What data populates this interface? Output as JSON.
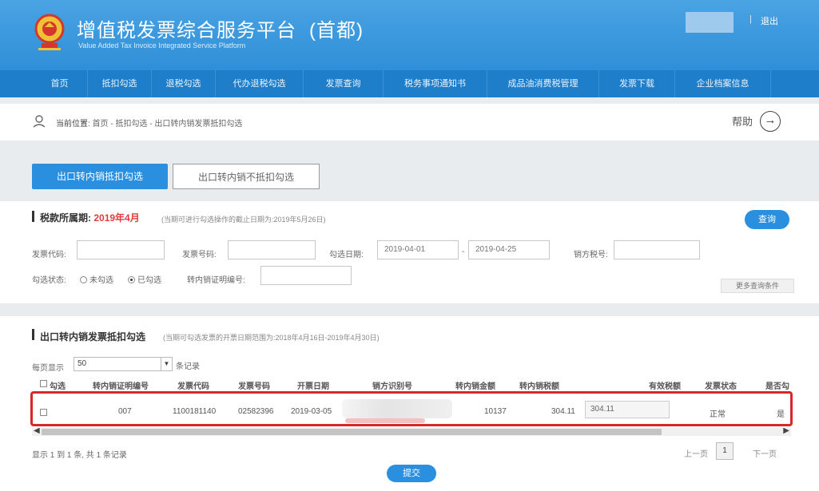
{
  "header": {
    "title": "增值税发票综合服务平台",
    "region": "(首都)",
    "subtitle": "Value Added Tax Invoice Integrated Service Platform",
    "logout": "退出",
    "separator": "|",
    "colors": {
      "header": "#3a9be0",
      "nav": "#1f7ec9",
      "primary": "#2b8fe0",
      "alert": "#d9262a"
    }
  },
  "nav": {
    "items": [
      "首页",
      "抵扣勾选",
      "退税勾选",
      "代办退税勾选",
      "发票查询",
      "税务事项通知书",
      "成品油消费税管理",
      "发票下载",
      "企业档案信息"
    ]
  },
  "breadcrumb": {
    "label": "当前位置:",
    "path": "首页 - 抵扣勾选 - 出口转内销发票抵扣勾选"
  },
  "help": {
    "label": "帮助"
  },
  "tabs": {
    "active": "出口转内销抵扣勾选",
    "inactive": "出口转内销不抵扣勾选"
  },
  "period": {
    "label": "税款所属期:",
    "value": "2019年4月",
    "note": "(当期可进行勾选操作的截止日期为:2019年5月26日)",
    "query_button": "查询"
  },
  "filters": {
    "invoice_code_label": "发票代码:",
    "invoice_number_label": "发票号码:",
    "check_date_label": "勾选日期:",
    "date_from": "2019-04-01",
    "date_sep": "-",
    "date_to": "2019-04-25",
    "seller_tax_label": "销方税号:",
    "status_label": "勾选状态:",
    "status_unchecked": "未勾选",
    "status_checked": "已勾选",
    "cert_number_label": "转内销证明编号:",
    "more_label": "更多查询条件"
  },
  "result": {
    "title": "出口转内销发票抵扣勾选",
    "note": "(当期可勾选发票的开票日期范围为:2018年4月16日-2019年4月30日)",
    "page_size_label": "每页显示",
    "page_size": "50",
    "records_suffix": "条记录",
    "columns": [
      "勾选",
      "转内销证明编号",
      "发票代码",
      "发票号码",
      "开票日期",
      "销方识别号",
      "转内销金额",
      "转内销税额",
      "有效税额",
      "发票状态",
      "是否勾"
    ],
    "rows": [
      {
        "cert_no": "007",
        "invoice_code": "1100181140",
        "invoice_no": "02582396",
        "date": "2019-03-05",
        "amount": "10137",
        "tax": "304.11",
        "valid_tax": "304.11",
        "status": "正常",
        "checked": "是"
      }
    ],
    "summary": "显示 1 到 1 条, 共 1 条记录",
    "prev": "上一页",
    "current_page": "1",
    "next": "下一页",
    "submit": "提交"
  }
}
